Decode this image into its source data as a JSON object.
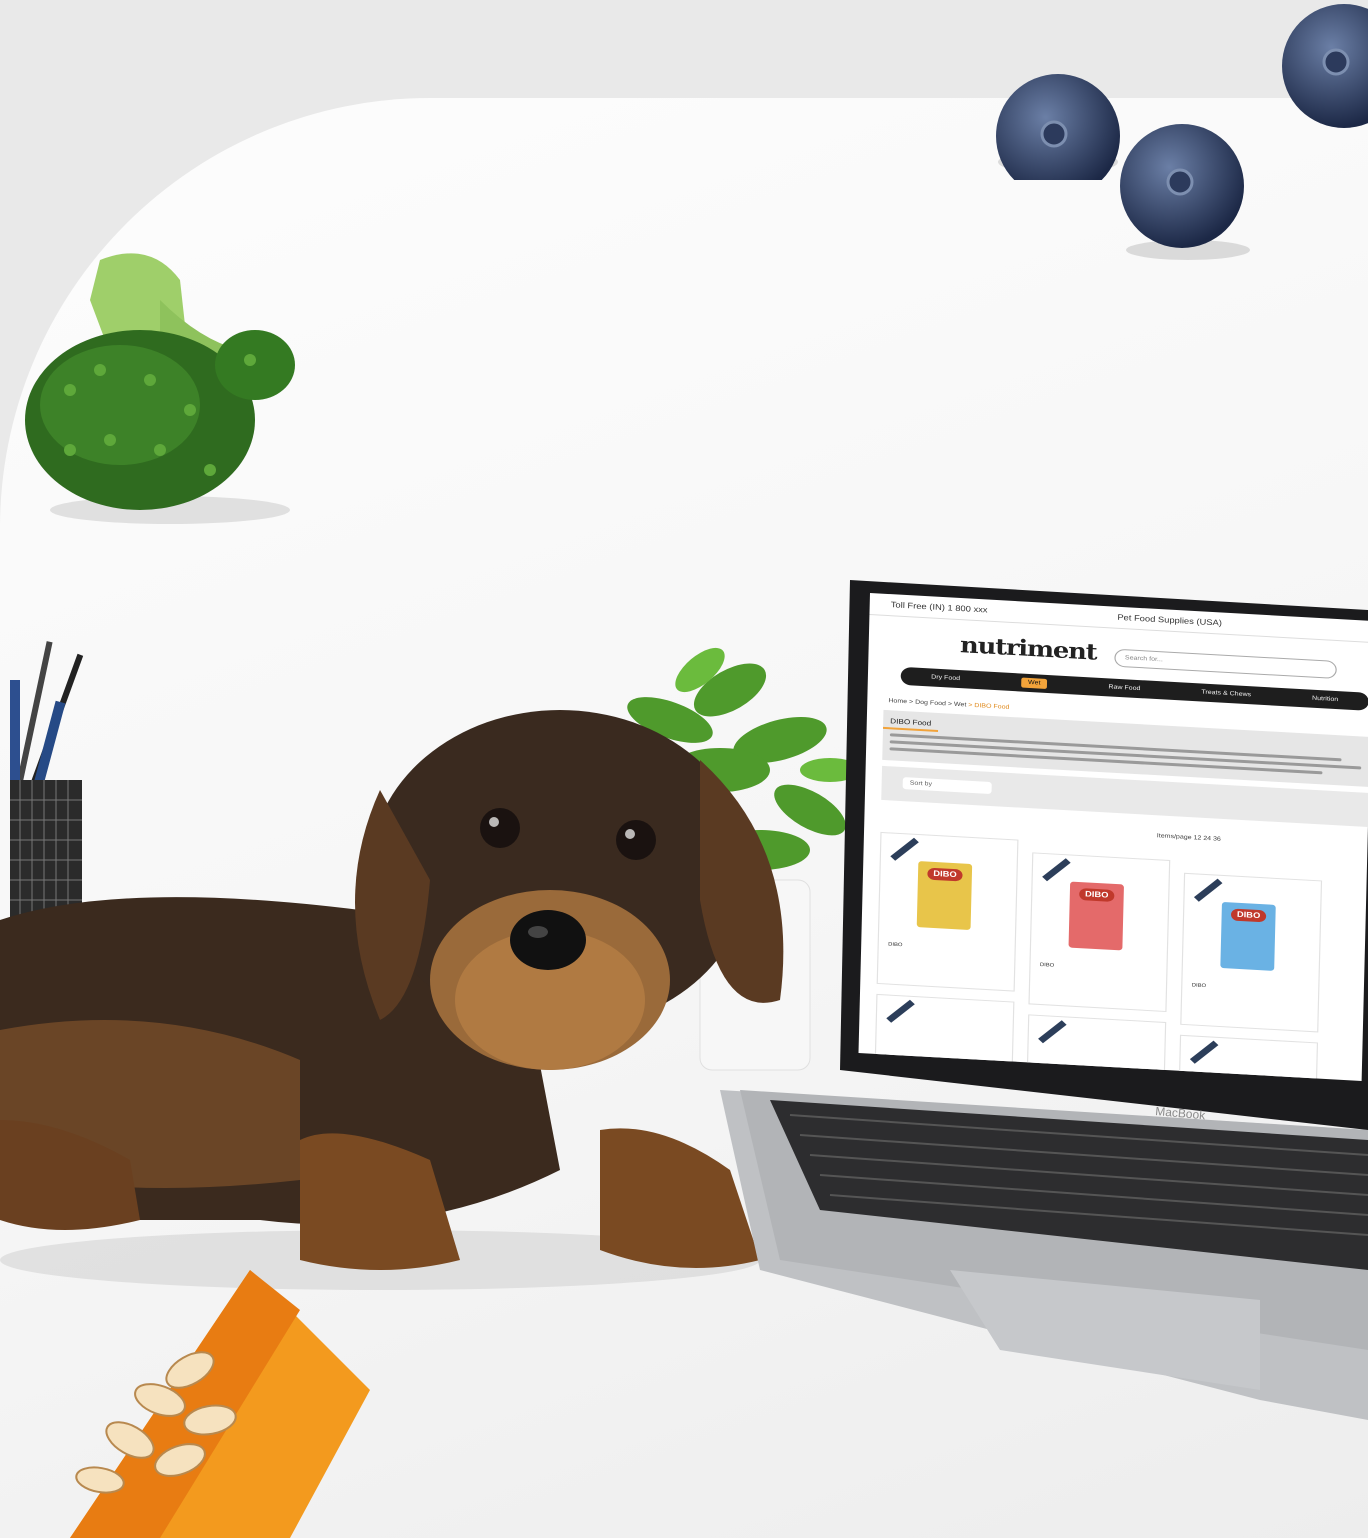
{
  "photo": {
    "subject": "dachshund-and-laptop",
    "props": [
      "broccoli-icon",
      "blueberry-icon",
      "pumpkin-icon",
      "pen-holder-icon",
      "plant-icon"
    ]
  },
  "laptop_screen": {
    "topbar": {
      "left": "Toll Free (IN) 1 800 xxx",
      "center": "Pet Food Supplies (USA)",
      "right": ""
    },
    "logo": "nutriment",
    "search_placeholder": "Search for...",
    "nav": [
      "Dry Food",
      "Wet",
      "Raw Food",
      "Treats & Chews",
      "Nutrition"
    ],
    "nav_active_index": 1,
    "breadcrumb": "Home > Dog Food > Wet",
    "breadcrumb_current": "> DIBO Food",
    "section_title": "DIBO Food",
    "sort_label": "Sort by",
    "showing_text": "Items/page 12  24  36",
    "products": [
      {
        "name": "DIBO",
        "price": "",
        "color": "#e8c54a"
      },
      {
        "name": "DIBO",
        "price": "",
        "color": "#e46a6a"
      },
      {
        "name": "DIBO",
        "price": "",
        "color": "#6ab2e4"
      }
    ],
    "pack_brand": "DIBO"
  },
  "laptop_brand": "MacBook"
}
